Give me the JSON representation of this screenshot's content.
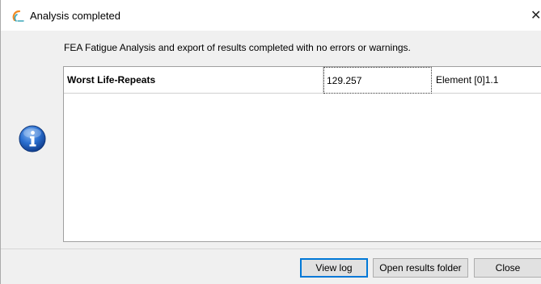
{
  "window": {
    "title": "Analysis completed",
    "close_glyph": "✕",
    "icon": "app-arc-icon"
  },
  "message": "FEA Fatigue Analysis and export of results completed with no errors or warnings.",
  "results": {
    "rows": [
      {
        "name": "Worst Life-Repeats",
        "value": "129.257",
        "element": "Element [0]1.1"
      }
    ]
  },
  "status_icon": "info-icon",
  "buttons": {
    "view_log": "View log",
    "open_results_folder": "Open results folder",
    "close": "Close"
  },
  "colors": {
    "info_blue": "#1f5fbf",
    "focus_border": "#0078d7",
    "app_icon_orange": "#f08a24",
    "app_icon_teal": "#3aa6b9"
  }
}
